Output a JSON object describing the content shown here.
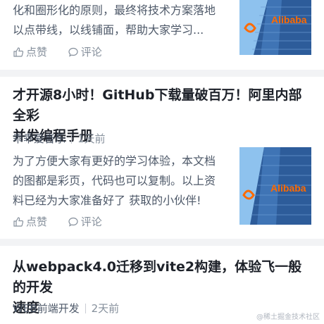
{
  "articles": [
    {
      "summary_lines": [
        "化和圈形化的原则，最终将技术方案落地",
        "以点带线，以线铺面，帮助大家学习..."
      ],
      "like_label": "点赞",
      "comment_label": "评论",
      "thumb_text": "Alibaba"
    },
    {
      "title_lines": [
        "才开源8小时！GitHub下载量破百万！阿里内部全彩",
        "并发编程手册"
      ],
      "author": "乖乖爱音乐",
      "time": "1天前",
      "summary_lines": [
        "为了方便大家有更好的学习体验，本文档",
        "的图都是彩页，代码也可以复制。以上资",
        "料已经为大家准备好了 获取的小伙伴!"
      ],
      "like_label": "点赞",
      "comment_label": "评论",
      "thumb_text": "Alibaba"
    },
    {
      "title_lines": [
        "从webpack4.0迁移到vite2构建，体验飞一般的开发",
        "速度"
      ],
      "author": "WEB前端开发",
      "time": "2天前"
    }
  ],
  "watermark": "@稀土掘金技术社区",
  "colors": {
    "divider": "#f2f3f5",
    "thumb_sky": "#7fb6e6",
    "thumb_building": "#2d5c9a",
    "thumb_logo": "#ff6a00"
  }
}
